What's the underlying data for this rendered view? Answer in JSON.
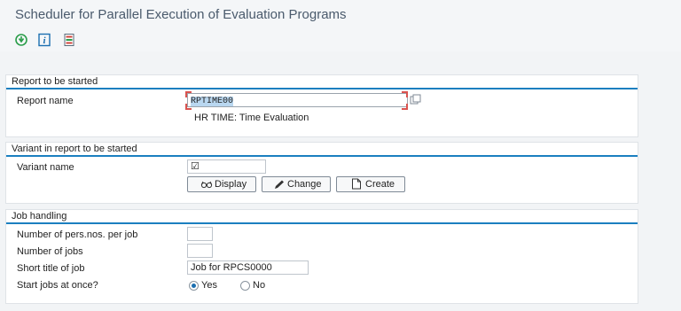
{
  "window": {
    "title": "Scheduler for Parallel Execution of Evaluation Programs"
  },
  "toolbar": {
    "icons": [
      "execute-icon",
      "information-icon",
      "program-list-icon"
    ]
  },
  "report_group": {
    "title": "Report to be started",
    "report_name_label": "Report name",
    "report_name_value": "RPTIME00",
    "report_description": "HR TIME: Time Evaluation"
  },
  "variant_group": {
    "title": "Variant in report to be started",
    "variant_name_label": "Variant name",
    "variant_name_value": "☑",
    "display_label": "Display",
    "change_label": "Change",
    "create_label": "Create"
  },
  "job_group": {
    "title": "Job handling",
    "pers_per_job_label": "Number of pers.nos. per job",
    "pers_per_job_value": "",
    "num_jobs_label": "Number of jobs",
    "num_jobs_value": "",
    "short_title_label": "Short title of job",
    "short_title_value": "Job for RPCS0000",
    "start_jobs_label": "Start jobs at once?",
    "yes_label": "Yes",
    "no_label": "No",
    "start_jobs_selected": "Yes"
  },
  "colors": {
    "accent": "#1b7fc0",
    "focus": "#d9534f",
    "selection": "#b9d7f0"
  }
}
